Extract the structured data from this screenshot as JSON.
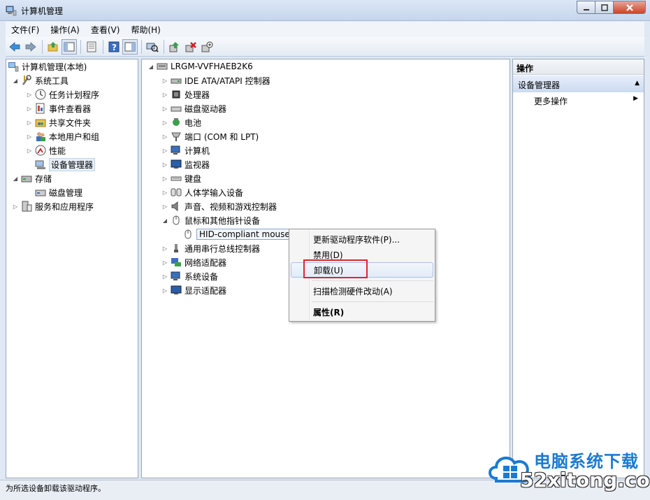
{
  "window": {
    "title": "计算机管理",
    "min": "0",
    "max": "1",
    "close": "r"
  },
  "menu": [
    "文件(F)",
    "操作(A)",
    "查看(V)",
    "帮助(H)"
  ],
  "left_tree": {
    "root": "计算机管理(本地)",
    "system_tools": "系统工具",
    "items": [
      "任务计划程序",
      "事件查看器",
      "共享文件夹",
      "本地用户和组",
      "性能",
      "设备管理器"
    ],
    "storage": "存储",
    "disk_mgmt": "磁盘管理",
    "services": "服务和应用程序"
  },
  "device_tree": {
    "computer": "LRGM-VVFHAEB2K6",
    "categories": [
      "IDE ATA/ATAPI 控制器",
      "处理器",
      "磁盘驱动器",
      "电池",
      "端口 (COM 和 LPT)",
      "计算机",
      "监视器",
      "键盘",
      "人体学输入设备",
      "声音、视频和游戏控制器",
      "鼠标和其他指针设备"
    ],
    "mouse_device": "HID-compliant mouse",
    "categories_after": [
      "通用串行总线控制器",
      "网络适配器",
      "系统设备",
      "显示适配器"
    ]
  },
  "context_menu": {
    "update": "更新驱动程序软件(P)...",
    "disable": "禁用(D)",
    "uninstall": "卸载(U)",
    "scan": "扫描检测硬件改动(A)",
    "properties": "属性(R)"
  },
  "actions": {
    "header": "操作",
    "section": "设备管理器",
    "more": "更多操作"
  },
  "status": "为所选设备卸载该驱动程序。",
  "watermark": {
    "cn": "电脑系统下载",
    "en": "52xitong.com"
  },
  "colors": {
    "highlight_box": "#e0242a",
    "watermark_blue": "#1b7ad1"
  }
}
